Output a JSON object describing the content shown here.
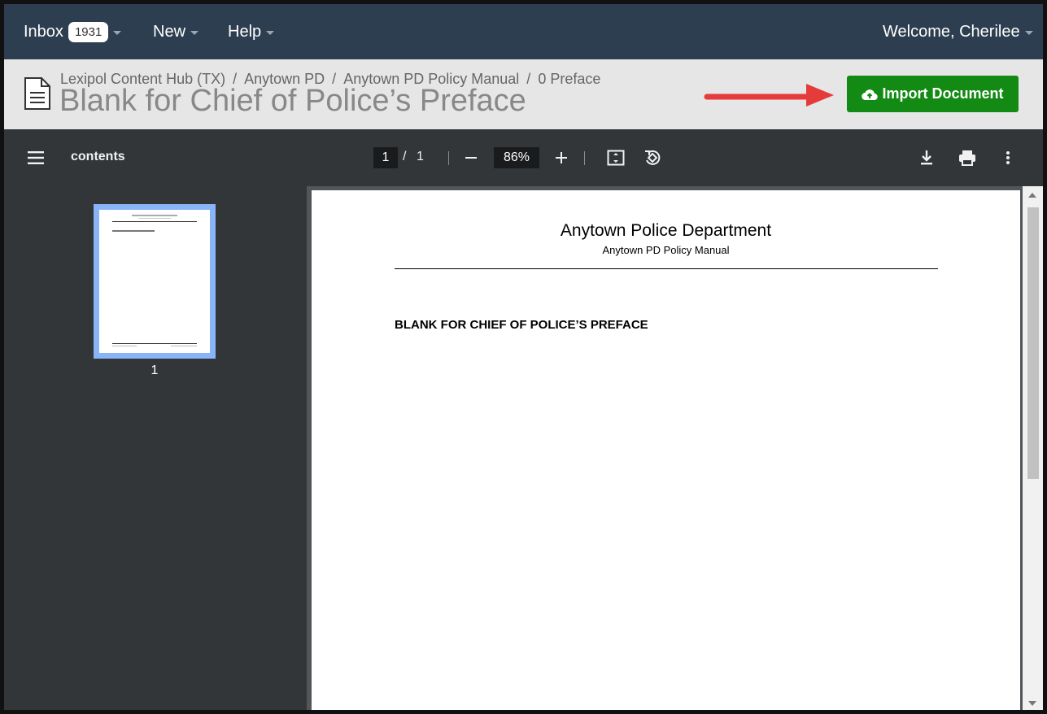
{
  "nav": {
    "inbox_label": "Inbox",
    "inbox_count": "1931",
    "new_label": "New",
    "help_label": "Help",
    "welcome": "Welcome, Cherilee"
  },
  "header": {
    "breadcrumb": [
      "Lexipol Content Hub (TX)",
      "Anytown PD",
      "Anytown PD Policy Manual",
      "0 Preface"
    ],
    "breadcrumb_separator": "/",
    "title": "Blank for Chief of Police’s Preface",
    "import_button": "Import Document",
    "import_button_color": "#138a13",
    "annotation_arrow_color": "#e53b3b"
  },
  "viewer": {
    "menu_icon": "hamburger-menu-icon",
    "sidebar_title": "contents",
    "current_page": "1",
    "page_separator": "/",
    "total_pages": "1",
    "zoom": "86%",
    "toolbar_icons": [
      "zoom-out-icon",
      "zoom-in-icon",
      "fit-page-icon",
      "rotate-icon",
      "download-icon",
      "print-icon",
      "more-vert-icon"
    ]
  },
  "thumbnails": [
    {
      "label": "1",
      "selected": true
    }
  ],
  "document": {
    "department": "Anytown Police Department",
    "manual": "Anytown PD Policy Manual",
    "heading": "BLANK FOR CHIEF OF POLICE’S PREFACE"
  }
}
